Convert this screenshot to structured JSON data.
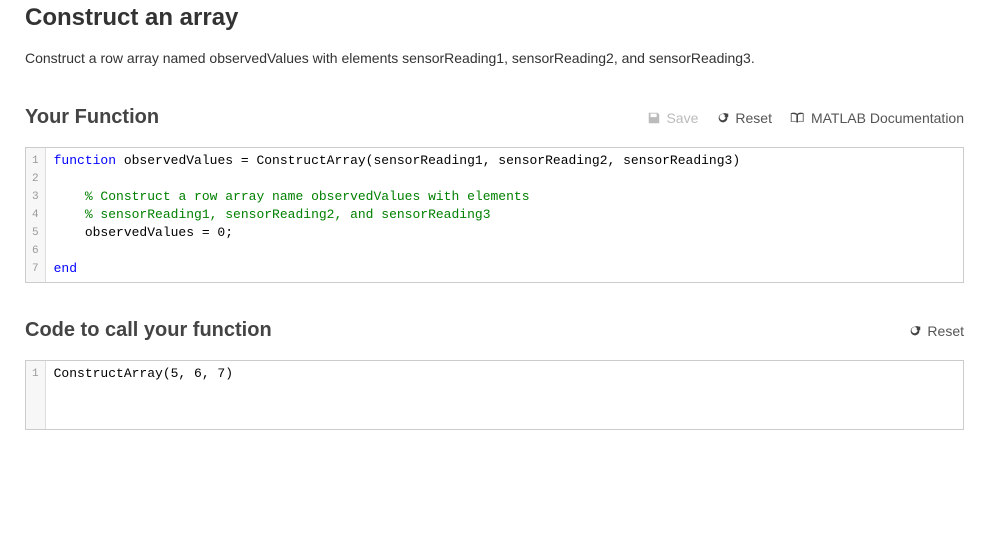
{
  "page": {
    "title": "Construct an array",
    "description": "Construct a row array named observedValues with elements sensorReading1, sensorReading2, and sensorReading3."
  },
  "function_section": {
    "title": "Your Function",
    "toolbar": {
      "save_label": "Save",
      "reset_label": "Reset",
      "docs_label": "MATLAB Documentation"
    },
    "code_lines": [
      [
        {
          "text": "function",
          "cls": "tok-keyword"
        },
        {
          "text": " observedValues = ConstructArray(sensorReading1, sensorReading2, sensorReading3)",
          "cls": "tok-plain"
        }
      ],
      [],
      [
        {
          "text": "    ",
          "cls": "tok-plain"
        },
        {
          "text": "% Construct a row array name observedValues with elements",
          "cls": "tok-comment"
        }
      ],
      [
        {
          "text": "    ",
          "cls": "tok-plain"
        },
        {
          "text": "% sensorReading1, sensorReading2, and sensorReading3",
          "cls": "tok-comment"
        }
      ],
      [
        {
          "text": "    observedValues = 0;",
          "cls": "tok-plain"
        }
      ],
      [],
      [
        {
          "text": "end",
          "cls": "tok-keyword"
        }
      ]
    ]
  },
  "caller_section": {
    "title": "Code to call your function",
    "toolbar": {
      "reset_label": "Reset"
    },
    "code_lines": [
      [
        {
          "text": "ConstructArray(5, 6, 7)",
          "cls": "tok-plain"
        }
      ]
    ]
  }
}
